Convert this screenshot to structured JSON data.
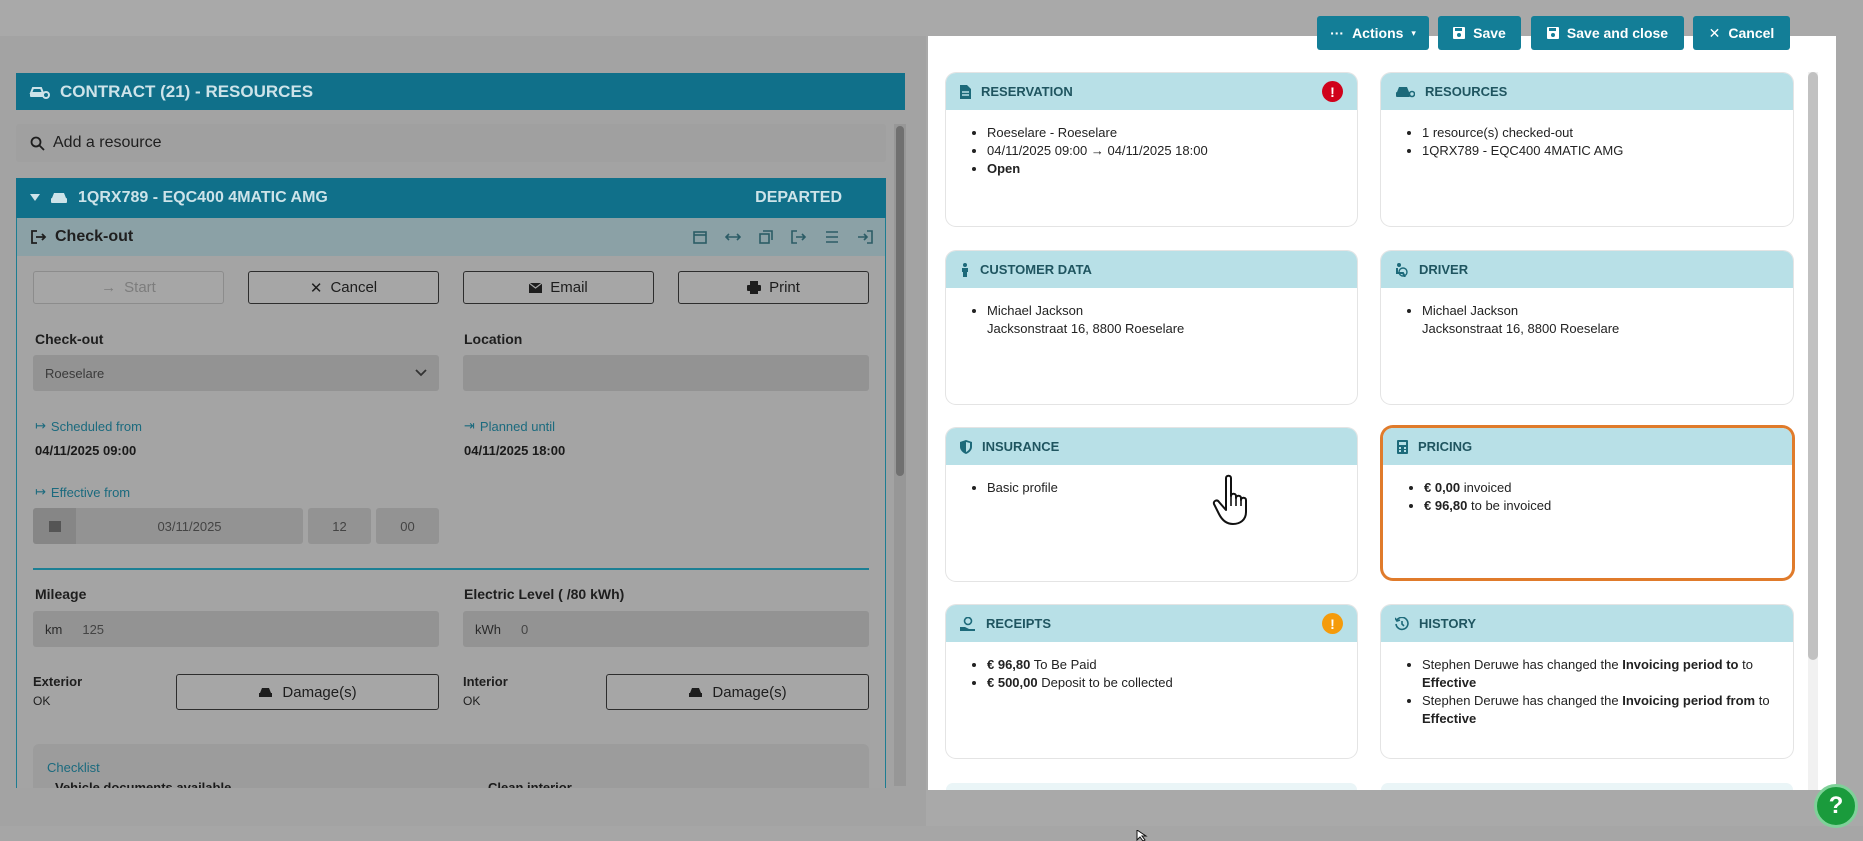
{
  "toolbar": {
    "actions_label": "Actions",
    "save_label": "Save",
    "save_close_label": "Save and close",
    "cancel_label": "Cancel"
  },
  "contract": {
    "title": "CONTRACT (21) - RESOURCES",
    "add_resource": "Add a resource"
  },
  "resource": {
    "title": "1QRX789 - EQC400 4MATIC AMG",
    "status": "DEPARTED",
    "section": "Check-out",
    "buttons": {
      "start": "Start",
      "cancel": "Cancel",
      "email": "Email",
      "print": "Print"
    },
    "checkout_label": "Check-out",
    "checkout_value": "Roeselare",
    "location_label": "Location",
    "scheduled_from_label": "Scheduled from",
    "scheduled_from_value": "04/11/2025 09:00",
    "planned_until_label": "Planned until",
    "planned_until_value": "04/11/2025 18:00",
    "effective_from_label": "Effective from",
    "effective_date": "03/11/2025",
    "effective_hour": "12",
    "effective_minute": "00",
    "mileage_label": "Mileage",
    "mileage_unit": "km",
    "mileage_value": "125",
    "electric_label": "Electric Level ( /80 kWh)",
    "electric_unit": "kWh",
    "electric_value": "0",
    "exterior_label": "Exterior",
    "exterior_value": "OK",
    "interior_label": "Interior",
    "interior_value": "OK",
    "damage_label": "Damage(s)",
    "checklist_label": "Checklist",
    "checklist_item_1": "Vehicle documents available",
    "checklist_item_2": "Clean interior"
  },
  "cards": {
    "reservation": {
      "title": "RESERVATION",
      "items": [
        "Roeselare - Roeselare",
        "04/11/2025 09:00 → 04/11/2025 18:00",
        "Open"
      ],
      "badge": "!"
    },
    "resources": {
      "title": "RESOURCES",
      "items": [
        "1 resource(s) checked-out",
        "1QRX789 - EQC400 4MATIC AMG"
      ]
    },
    "customer": {
      "title": "CUSTOMER DATA",
      "name": "Michael Jackson",
      "address": "Jacksonstraat 16, 8800 Roeselare"
    },
    "driver": {
      "title": "DRIVER",
      "name": "Michael Jackson",
      "address": "Jacksonstraat 16, 8800 Roeselare"
    },
    "insurance": {
      "title": "INSURANCE",
      "items": [
        "Basic profile"
      ]
    },
    "pricing": {
      "title": "PRICING",
      "amount1": "€ 0,00",
      "text1": " invoiced",
      "amount2": "€ 96,80",
      "text2": " to be invoiced"
    },
    "receipts": {
      "title": "RECEIPTS",
      "amount1": "€ 96,80",
      "text1": " To Be Paid",
      "amount2": "€ 500,00",
      "text2": " Deposit to be collected",
      "badge": "!"
    },
    "history": {
      "title": "HISTORY",
      "e1_pre": "Stephen Deruwe has changed the ",
      "e1_field": "Invoicing period to",
      "e1_mid": " to ",
      "e1_value": "Effective",
      "e2_pre": "Stephen Deruwe has changed the ",
      "e2_field": "Invoicing period from",
      "e2_mid": " to ",
      "e2_value": "Effective"
    }
  },
  "help_label": "?",
  "colors": {
    "accent": "#137e97",
    "highlight": "#e07b2b",
    "error": "#d0021b",
    "warning": "#f59b0b",
    "help": "#1a9b3c"
  }
}
